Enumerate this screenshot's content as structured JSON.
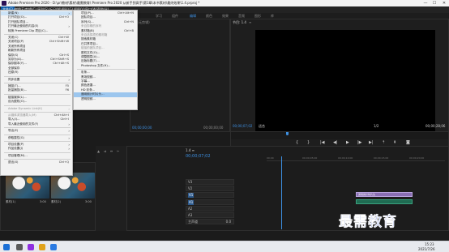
{
  "window": {
    "title": "Adobe Premiere Pro 2020 - D:\\pr\\教材\\素材\\最需教育\\ Premiere Pro 2020 从新手到高手\\第1章\\本书素材\\最终效果\\1.4.prproj *",
    "min": "—",
    "max": "☐",
    "close": "✕"
  },
  "menubar": [
    "文件(F)",
    "编辑(E)",
    "剪辑(C)",
    "序列(S)",
    "标记(M)",
    "图形(G)",
    "视图(V)",
    "窗口(W)",
    "帮助(H)"
  ],
  "workspaces": [
    "学习",
    "组件",
    "编辑",
    "颜色",
    "效果",
    "音频",
    "图形",
    "库"
  ],
  "file_menu": [
    {
      "label": "新建(N)",
      "sc": "",
      "sub": true,
      "state": "hl"
    },
    {
      "label": "打开项目(O)...",
      "sc": "Ctrl+O"
    },
    {
      "label": "打开团队项目...",
      "sc": ""
    },
    {
      "label": "打开最近使用的内容(E)",
      "sc": "",
      "sub": true
    },
    {
      "label": "转换 Premiere Clip 项目(C)...",
      "sc": ""
    },
    {
      "sep": true
    },
    {
      "label": "关闭(C)",
      "sc": "Ctrl+W"
    },
    {
      "label": "关闭项目(P)",
      "sc": "Ctrl+Shift+W"
    },
    {
      "label": "关闭所有项目",
      "sc": ""
    },
    {
      "label": "刷新所有项目",
      "sc": ""
    },
    {
      "label": "保存(S)",
      "sc": "Ctrl+S"
    },
    {
      "label": "另存为(A)...",
      "sc": "Ctrl+Shift+S"
    },
    {
      "label": "保存副本(Y)...",
      "sc": "Ctrl+Alt+S"
    },
    {
      "label": "全部保存",
      "sc": ""
    },
    {
      "label": "还原(R)",
      "sc": ""
    },
    {
      "sep": true
    },
    {
      "label": "同步设置",
      "sc": "",
      "sub": true
    },
    {
      "sep": true
    },
    {
      "label": "捕捉(T)...",
      "sc": "F5"
    },
    {
      "label": "批量捕捉(B)...",
      "sc": "F6"
    },
    {
      "sep": true
    },
    {
      "label": "链接媒体(L)...",
      "sc": ""
    },
    {
      "label": "设为脱机(O)...",
      "sc": ""
    },
    {
      "sep": true
    },
    {
      "label": "Adobe Dynamic Link(K)",
      "sc": "",
      "sub": true,
      "state": "dis"
    },
    {
      "sep": true
    },
    {
      "label": "从媒体浏览器导入(M)",
      "sc": "Ctrl+Alt+I",
      "state": "dis"
    },
    {
      "label": "导入(I)...",
      "sc": "Ctrl+I"
    },
    {
      "label": "导入最近使用的文件(F)",
      "sc": "",
      "sub": true
    },
    {
      "sep": true
    },
    {
      "label": "导出(E)",
      "sc": "",
      "sub": true
    },
    {
      "sep": true
    },
    {
      "label": "获取属性(G)",
      "sc": "",
      "sub": true
    },
    {
      "sep": true
    },
    {
      "label": "项目设置(P)",
      "sc": "",
      "sub": true
    },
    {
      "label": "作品设置(J)",
      "sc": "",
      "sub": true
    },
    {
      "sep": true
    },
    {
      "label": "项目管理(M)...",
      "sc": ""
    },
    {
      "sep": true
    },
    {
      "label": "退出(X)",
      "sc": "Ctrl+Q"
    }
  ],
  "new_submenu": [
    {
      "label": "项目(P)...",
      "sc": "Ctrl+Alt+N"
    },
    {
      "label": "团队项目...",
      "sc": ""
    },
    {
      "label": "序列(S)...",
      "sc": "Ctrl+N"
    },
    {
      "label": "来自剪辑的序列",
      "sc": "",
      "state": "dis"
    },
    {
      "label": "素材箱(B)",
      "sc": "Ctrl+B"
    },
    {
      "label": "来自选择项的素材箱",
      "sc": "",
      "state": "dis"
    },
    {
      "label": "搜索素材箱",
      "sc": ""
    },
    {
      "label": "已共享项目...",
      "sc": ""
    },
    {
      "label": "链接的团队项目...",
      "sc": "",
      "state": "dis"
    },
    {
      "label": "脱机文件(O)...",
      "sc": ""
    },
    {
      "label": "调整图层(A)...",
      "sc": ""
    },
    {
      "label": "旧版标题(T)...",
      "sc": ""
    },
    {
      "label": "Photoshop 文件(H)...",
      "sc": ""
    },
    {
      "sep": true
    },
    {
      "label": "彩条...",
      "sc": ""
    },
    {
      "label": "黑场视频...",
      "sc": ""
    },
    {
      "label": "字幕...",
      "sc": ""
    },
    {
      "label": "颜色遮罩...",
      "sc": ""
    },
    {
      "label": "HD 彩条...",
      "sc": ""
    },
    {
      "label": "通用倒计时片头...",
      "sc": "",
      "state": "hlsub"
    },
    {
      "label": "透明视频...",
      "sc": ""
    }
  ],
  "program": {
    "title": "节目: 1.4",
    "menu": "≡",
    "timecode": "00;00;07;02",
    "fit": "适合",
    "ratio": "1/2",
    "duration": "00;00;28;06",
    "src_tc1": "00;00;00;00",
    "src_tc2": "00;00;00;00"
  },
  "source": {
    "title": "源: (无剪辑)"
  },
  "project": {
    "items": [
      {
        "name": "素材(1)",
        "meta": "3:00"
      },
      {
        "name": "素材(2)",
        "meta": "3:00"
      }
    ]
  },
  "timeline": {
    "title": "1.4 ≡",
    "timecode": "00;00;07;02",
    "ruler": [
      "00;00",
      "00;00;05;00",
      "00;00;10;00",
      "00;00;15;00",
      "00;00;20;00",
      "00;00;25;00"
    ],
    "tracks": [
      "V3",
      "V2",
      "V1",
      "A1",
      "A2",
      "A3",
      "主声道"
    ],
    "master_level": "0.0",
    "clip_v": "通用倒计时片头",
    "clip_a": ""
  },
  "watermark": "最需教育",
  "taskbar": {
    "time": "15:23",
    "date": "2021/7/26"
  }
}
